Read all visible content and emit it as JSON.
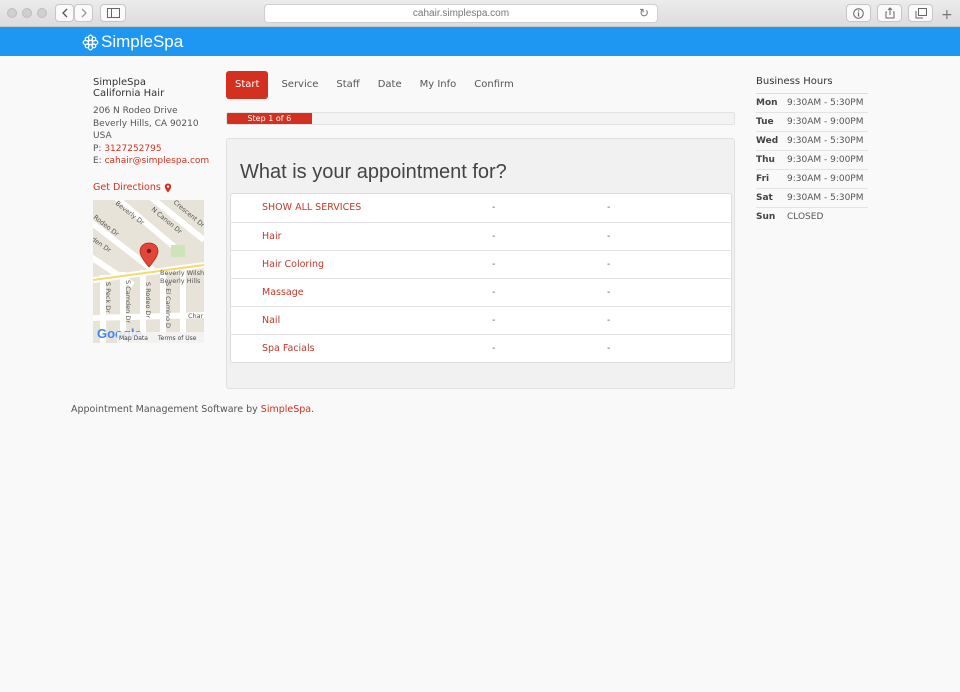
{
  "browser": {
    "url": "cahair.simplespa.com"
  },
  "brand": {
    "name": "SimpleSpa"
  },
  "business": {
    "name_line1": "SimpleSpa",
    "name_line2": "California Hair",
    "address_line1": "206 N Rodeo Drive",
    "address_line2": "Beverly Hills, CA 90210",
    "country": "USA",
    "phone_prefix": "P: ",
    "phone": "3127252795",
    "email_prefix": "E: ",
    "email": "cahair@simplespa.com",
    "directions_label": "Get Directions"
  },
  "map": {
    "street_labels": [
      "Rodeo Dr",
      "Beverly Dr",
      "N Canon Dr",
      "Crescent Dr",
      "Beverly Wilsh",
      "Beverly Hills",
      "S Peck Dr",
      "S Camden Dr",
      "S Rodeo Dr",
      "S El Camino D",
      "Char",
      "den Dr"
    ],
    "logo": "Google",
    "map_data_label": "Map Data",
    "terms_label": "Terms of Use"
  },
  "tabs": [
    {
      "label": "Start",
      "active": true
    },
    {
      "label": "Service",
      "active": false
    },
    {
      "label": "Staff",
      "active": false
    },
    {
      "label": "Date",
      "active": false
    },
    {
      "label": "My Info",
      "active": false
    },
    {
      "label": "Confirm",
      "active": false
    }
  ],
  "progress": {
    "label": "Step 1 of 6",
    "value": 0.167
  },
  "main": {
    "heading": "What is your appointment for?",
    "services": [
      {
        "name": "SHOW ALL SERVICES",
        "col2": "-",
        "col3": "-"
      },
      {
        "name": "Hair",
        "col2": "-",
        "col3": "-"
      },
      {
        "name": "Hair Coloring",
        "col2": "-",
        "col3": "-"
      },
      {
        "name": "Massage",
        "col2": "-",
        "col3": "-"
      },
      {
        "name": "Nail",
        "col2": "-",
        "col3": "-"
      },
      {
        "name": "Spa Facials",
        "col2": "-",
        "col3": "-"
      }
    ]
  },
  "hours": {
    "title": "Business Hours",
    "rows": [
      {
        "day": "Mon",
        "time": "9:30AM - 5:30PM"
      },
      {
        "day": "Tue",
        "time": "9:30AM - 9:00PM"
      },
      {
        "day": "Wed",
        "time": "9:30AM - 5:30PM"
      },
      {
        "day": "Thu",
        "time": "9:30AM - 9:00PM"
      },
      {
        "day": "Fri",
        "time": "9:30AM - 9:00PM"
      },
      {
        "day": "Sat",
        "time": "9:30AM - 5:30PM"
      },
      {
        "day": "Sun",
        "time": "CLOSED"
      }
    ]
  },
  "footer": {
    "prefix": "Appointment Management Software by ",
    "link": "SimpleSpa",
    "suffix": "."
  },
  "colors": {
    "accent": "#d3301f",
    "header": "#1e97f3"
  }
}
